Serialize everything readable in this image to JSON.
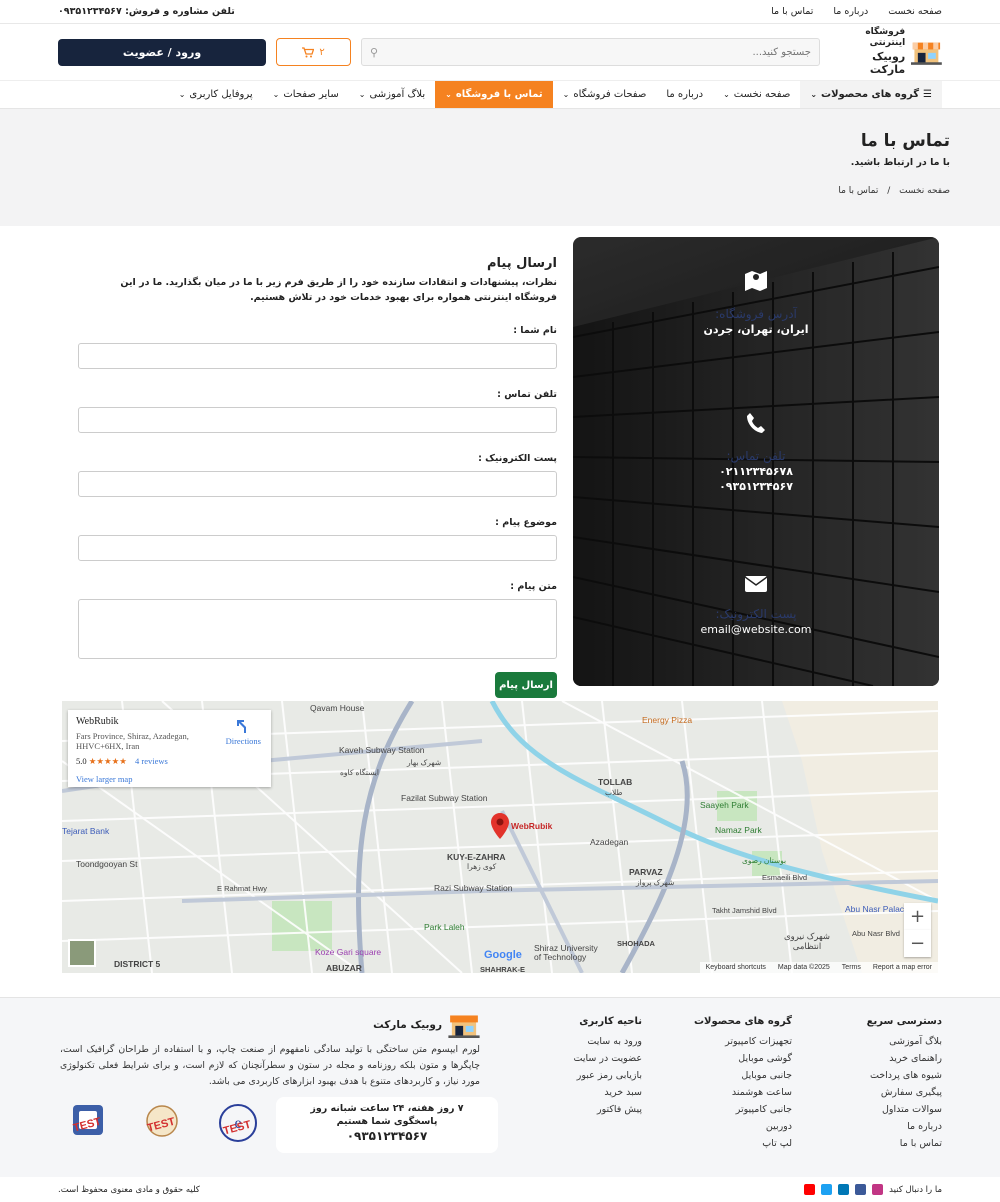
{
  "topbar": {
    "links": [
      "صفحه نخست",
      "درباره ما",
      "تماس با ما"
    ],
    "phone": "تلفن مشاوره و فروش: ۰۹۳۵۱۲۳۴۵۶۷"
  },
  "header": {
    "logo_line1": "فروشگاه اینترنتی",
    "logo_line2": "روبیک مارکت",
    "search_placeholder": "جستجو کنید...",
    "cart_count": "۲",
    "login_label": "ورود / عضویت"
  },
  "nav": [
    {
      "label": "گروه های محصولات",
      "chevron": true
    },
    {
      "label": "صفحه نخست",
      "chevron": true
    },
    {
      "label": "درباره ما",
      "chevron": false
    },
    {
      "label": "صفحات فروشگاه",
      "chevron": true
    },
    {
      "label": "تماس با فروشگاه",
      "chevron": true
    },
    {
      "label": "بلاگ آموزشی",
      "chevron": true
    },
    {
      "label": "سایر صفحات",
      "chevron": true
    },
    {
      "label": "پروفایل کاربری",
      "chevron": true
    }
  ],
  "banner": {
    "title": "تماس با ما",
    "subtitle": "با ما در ارتباط باشید.",
    "breadcrumb_home": "صفحه نخست",
    "breadcrumb_sep": "/",
    "breadcrumb_current": "تماس با ما"
  },
  "info": {
    "address_title": "آدرس فروشگاه:",
    "address": "ایران، تهران، جردن",
    "phone_title": "تلفن تماس:",
    "phone1": "۰۲۱۱۲۳۴۵۶۷۸",
    "phone2": "۰۹۳۵۱۲۳۴۵۶۷",
    "email_title": "پست الکترونیک:",
    "email": "email@website.com"
  },
  "form": {
    "title": "ارسال پیام",
    "intro": "نظرات، پیشنهادات و انتقادات سازنده خود را از طریق فرم زیر با ما در میان بگذارید. ما در این فروشگاه اینترنتی همواره برای بهبود خدمات خود در تلاش هستیم.",
    "name_label": "نام شما :",
    "phone_label": "تلفن تماس :",
    "email_label": "پست الکترونیک :",
    "subject_label": "موضوع پیام :",
    "message_label": "متن پیام :",
    "send_label": "ارسال پیام"
  },
  "map": {
    "place_name": "WebRubik",
    "address": "Fars Province, Shiraz, Azadegan, HHVC+6HX, Iran",
    "rating": "5.0",
    "stars": "★★★★★",
    "reviews": "4 reviews",
    "larger_map": "View larger map",
    "directions": "Directions",
    "marker_label": "WebRubik",
    "labels": {
      "qavam": "Qavam House",
      "energy": "Energy Pizza",
      "kaveh_station": "Kaveh Subway Station",
      "kaveh_station_fa": "ایستگاه کاوه",
      "bahar": "شهرک بهار",
      "tollab": "TOLLAB",
      "tollab_fa": "طلاب",
      "saayeh": "Saayeh Park",
      "namaz": "Namaz Park",
      "fazilat": "Fazilat Subway Station",
      "tejarat": "Tejarat Bank",
      "kuy": "KUY-E-ZAHRA",
      "kuy_fa": "کوی زهرا",
      "azadegan": "Azadegan",
      "parvaz": "PARVAZ",
      "parvaz_fa": "شهرک پرواز",
      "razi": "Razi Subway Station",
      "toondgooyan": "Toondgooyan St",
      "erahmat": "E Rahmat Hwy",
      "park_laleh": "Park Laleh",
      "koze_gari": "Koze Gari square",
      "district5": "DISTRICT 5",
      "abuzar": "ABUZAR",
      "shiraz_univ": "Shiraz University of Technology",
      "shohada": "SHOHADA",
      "abu_nasr": "Abu Nasr Palace",
      "niroo": "شهرک نیروی انتظامی",
      "bostan": "بوستان رصوی",
      "shahrak": "SHAHRAK-E",
      "esmaeili": "Esmaeili Blvd",
      "takht": "Takht Jamshid Blvd",
      "abu_nasr_blvd": "Abu Nasr Blvd"
    },
    "footer": [
      "Keyboard shortcuts",
      "Map data ©2025",
      "Terms",
      "Report a map error"
    ],
    "google": "Google"
  },
  "footer": {
    "quick_title": "دسترسی سریع",
    "quick": [
      "بلاگ آموزشی",
      "راهنمای خرید",
      "شیوه های پرداخت",
      "پیگیری سفارش",
      "سوالات متداول",
      "درباره ما",
      "تماس با ما"
    ],
    "groups_title": "گروه های محصولات",
    "groups": [
      "تجهیزات کامپیوتر",
      "گوشی موبایل",
      "جانبی موبایل",
      "ساعت هوشمند",
      "جانبی کامپیوتر",
      "دوربین",
      "لپ تاپ"
    ],
    "user_title": "ناحیه کاربری",
    "user": [
      "ورود به سایت",
      "عضویت در سایت",
      "بازیابی رمز عبور",
      "سبد خرید",
      "پیش فاکتور"
    ],
    "brand_name": "روبیک مارکت",
    "brand_text": "لورم ایپسوم متن ساختگی با تولید سادگی نامفهوم از صنعت چاپ، و با استفاده از طراحان گرافیک است، چاپگرها و متون بلکه روزنامه و مجله در ستون و سطرآنچنان که لازم است، و برای شرایط فعلی تکنولوژی مورد نیاز، و کاربردهای متنوع با هدف بهبود ابزارهای کاربردی می باشد.",
    "support_l1": "۷ روز هفته، ۲۴ ساعت شبانه روز",
    "support_l2": "پاسخگوی شما هستیم",
    "support_phone": "۰۹۳۵۱۲۳۴۵۶۷",
    "badge_enamad": "TEST",
    "badge_samandehi": "TEST",
    "badge_etehadieh": "TEST",
    "follow": "ما را دنبال کنید",
    "copyright": "کلیه حقوق و مادی معنوی محفوظ است."
  },
  "colors": {
    "accent": "#f58220",
    "login_bg": "#17243d",
    "send_bg": "#1a7a3c",
    "info_title": "#2a3a6a"
  }
}
